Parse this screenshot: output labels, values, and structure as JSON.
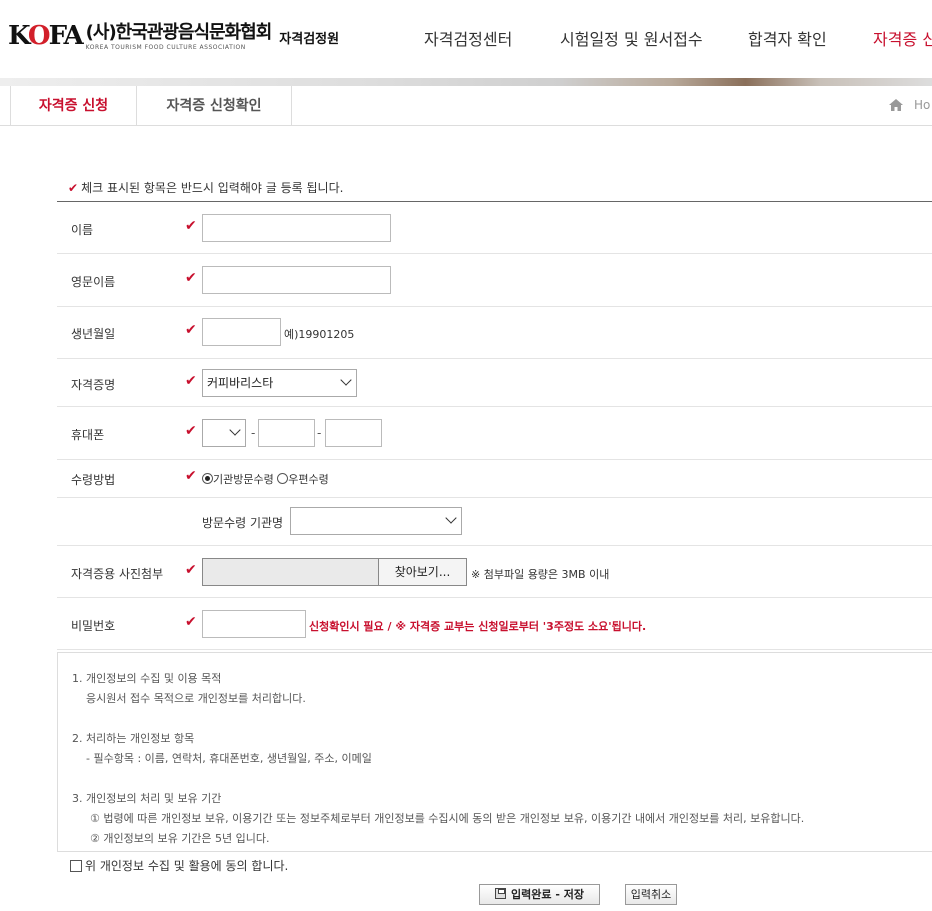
{
  "header": {
    "logo_mark": "KOFA",
    "logo_korean": "(사)한국관광음식문화협회",
    "logo_english": "KOREA TOURISM FOOD CULTURE ASSOCIATION",
    "logo_sub": "자격검정원",
    "nav": [
      "자격검정센터",
      "시험일정 및 원서접수",
      "합격자 확인",
      "자격증 신"
    ]
  },
  "subnav": {
    "tabs": [
      "자격증 신청",
      "자격증 신청확인"
    ],
    "home_label": "Ho"
  },
  "form": {
    "notice": "체크 표시된 항목은 반드시 입력해야 글 등록 됩니다.",
    "check_mark": "✔",
    "name_label": "이름",
    "english_name_label": "영문이름",
    "birth_label": "생년월일",
    "birth_example": "예)19901205",
    "cert_label": "자격증명",
    "cert_value": "커피바리스타",
    "phone_label": "휴대폰",
    "phone_sep": "-",
    "method_label": "수령방법",
    "method_options": [
      "기관방문수령",
      "우편수령"
    ],
    "method_selected": "기관방문수령",
    "visit_org_label": "방문수령 기관명",
    "photo_label": "자격증용 사진첨부",
    "browse_label": "찾아보기...",
    "photo_note": "※ 첨부파일 용량은 3MB 이내",
    "password_label": "비밀번호",
    "password_note": "신청확인시 필요 / ※ 자격증 교부는 신청일로부터 '3주정도 소요'됩니다."
  },
  "privacy": {
    "s1_title": "1. 개인정보의 수집 및 이용 목적",
    "s1_body": "응시원서 접수 목적으로 개인정보를 처리합니다.",
    "s2_title": "2. 처리하는 개인정보 항목",
    "s2_body": "- 필수항목 : 이름, 연락처, 휴대폰번호, 생년월일, 주소, 이메일",
    "s3_title": "3. 개인정보의 처리 및 보유 기간",
    "s3_item1": "① 법령에 따른 개인정보 보유, 이용기간 또는 정보주체로부터 개인정보를 수집시에 동의 받은 개인정보 보유, 이용기간 내에서 개인정보를 처리, 보유합니다.",
    "s3_item2": "② 개인정보의 보유 기간은 5년 입니다."
  },
  "agree_label": "위 개인정보 수집 및 활용에 동의 합니다.",
  "buttons": {
    "save": "입력완료 - 저장",
    "cancel": "입력취소"
  },
  "colors": {
    "accent": "#c8102e",
    "text": "#333333",
    "border": "#dddddd"
  }
}
